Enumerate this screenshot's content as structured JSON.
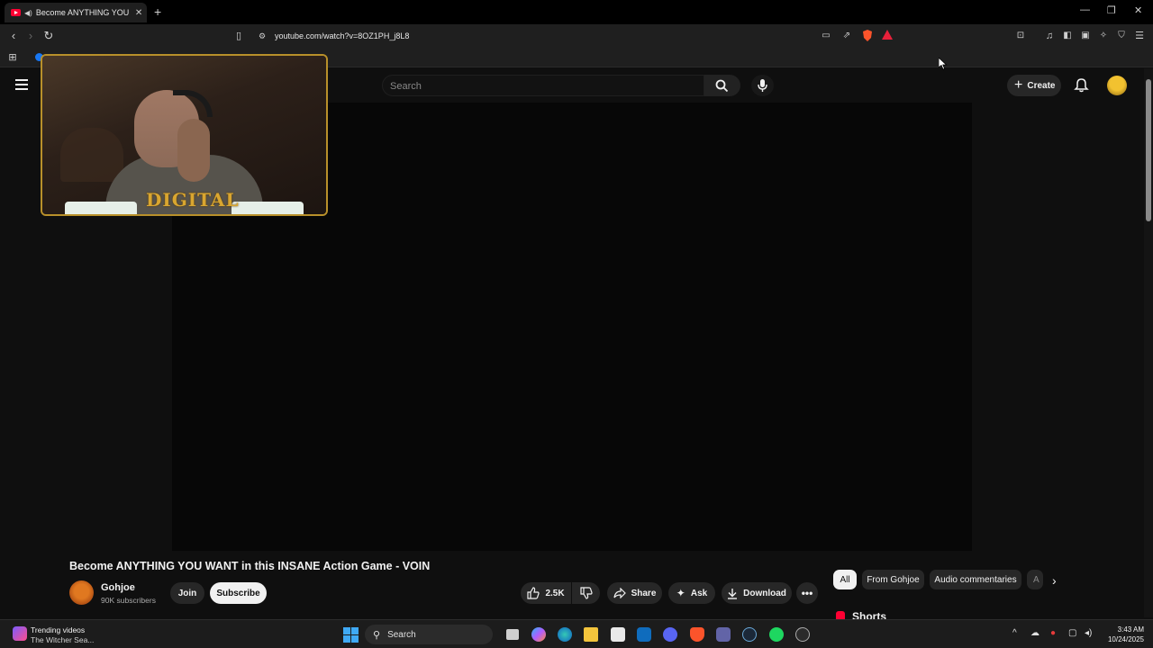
{
  "browser": {
    "tab_title": "Become ANYTHING YOU WA",
    "url": "youtube.com/watch?v=8OZ1PH_j8L8"
  },
  "header": {
    "search_placeholder": "Search",
    "create_label": "Create"
  },
  "webcam": {
    "overlay_text": "DIGITAL"
  },
  "video": {
    "title": "Become ANYTHING YOU WANT in this INSANE Action Game - VOIN",
    "channel_name": "Gohjoe",
    "subscribers": "90K subscribers",
    "join_label": "Join",
    "subscribe_label": "Subscribe",
    "likes": "2.5K",
    "share_label": "Share",
    "ask_label": "Ask",
    "download_label": "Download"
  },
  "sidebar": {
    "chips": [
      "All",
      "From Gohjoe",
      "Audio commentaries",
      "A"
    ],
    "active_chip": "All",
    "shorts_label": "Shorts"
  },
  "taskbar": {
    "widget_line1": "Trending videos",
    "widget_line2": "The Witcher Sea...",
    "search_label": "Search",
    "time": "3:43 AM",
    "date": "10/24/2025"
  },
  "colors": {
    "youtube_red": "#ff0033",
    "background": "#0f0f0f",
    "webcam_frame": "#b8902a"
  }
}
